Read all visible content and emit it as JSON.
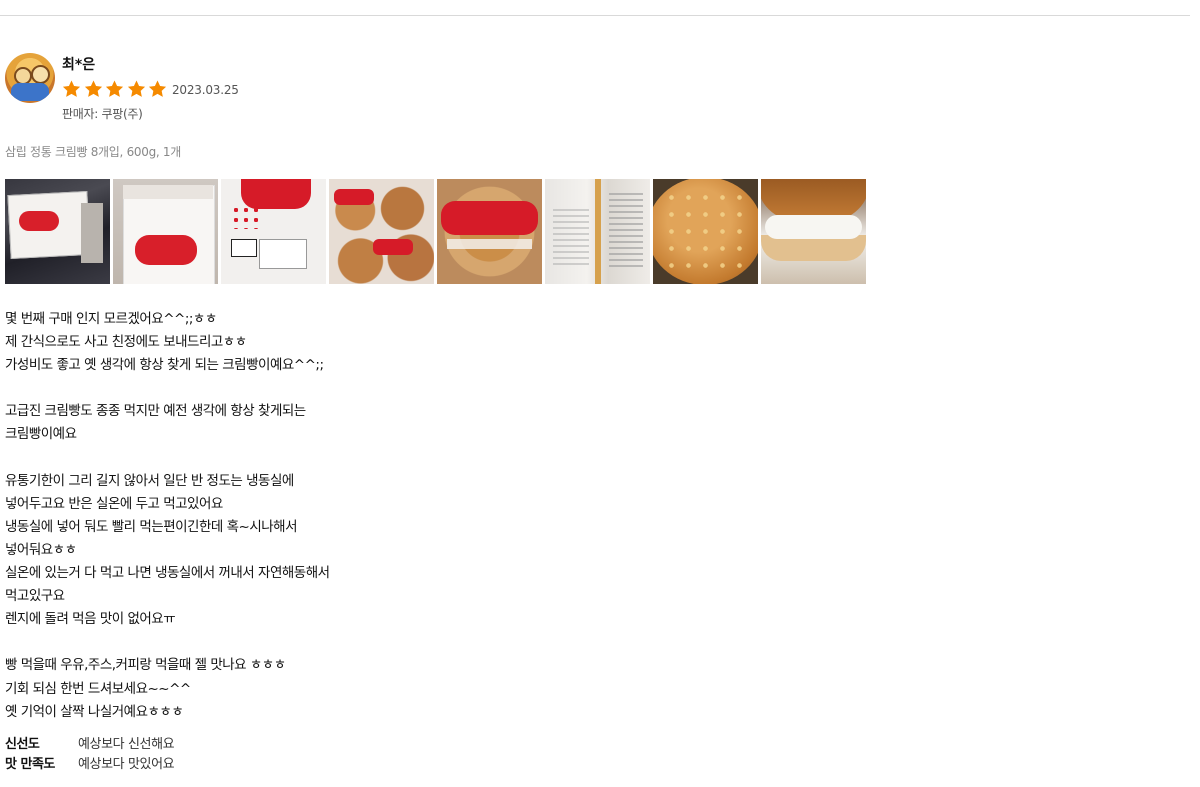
{
  "review": {
    "author": "최*은",
    "rating": 5,
    "rating_max": 5,
    "date": "2023.03.25",
    "seller": "판매자: 쿠팡(주)",
    "product": "삼립 정통 크림빵 8개입, 600g, 1개",
    "photos": [
      "photo-box-front",
      "photo-box-angle",
      "photo-box-detail",
      "photo-breads-pack",
      "photo-bread-label",
      "photo-back-label",
      "photo-bun-top",
      "photo-bun-cream"
    ],
    "content": "몇 번째 구매 인지 모르겠어요^^;;ㅎㅎ\n제 간식으로도 사고 친정에도 보내드리고ㅎㅎ\n가성비도 좋고 옛 생각에 항상 찾게 되는 크림빵이예요^^;;\n\n고급진 크림빵도 종종 먹지만 예전 생각에 항상 찾게되는\n크림빵이예요\n\n유통기한이 그리 길지 않아서 일단 반 정도는 냉동실에\n넣어두고요 반은 실온에 두고 먹고있어요\n냉동실에 넣어 둬도 빨리 먹는편이긴한데 혹~시나해서\n넣어둬요ㅎㅎ\n실온에 있는거 다 먹고 나면 냉동실에서 꺼내서 자연해동해서\n먹고있구요\n렌지에 돌려 먹음 맛이 없어요ㅠ\n\n빵 먹을때 우유,주스,커피랑 먹을때 젤 맛나요 ㅎㅎㅎ\n기회 되심 한번 드셔보세요~~^^\n옛 기억이 살짝 나실거예요ㅎㅎㅎ",
    "survey": [
      {
        "label": "신선도",
        "answer": "예상보다 신선해요"
      },
      {
        "label": "맛 만족도",
        "answer": "예상보다 맛있어요"
      }
    ]
  },
  "colors": {
    "star": "#f58a00",
    "divider": "#d9d9d9",
    "muted_text": "#888888"
  }
}
